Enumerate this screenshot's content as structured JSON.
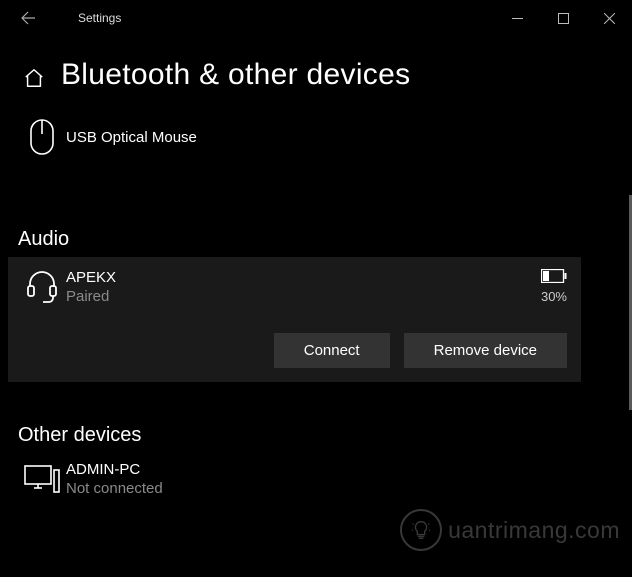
{
  "titlebar": {
    "title": "Settings"
  },
  "page": {
    "title": "Bluetooth & other devices"
  },
  "sections": {
    "mouse_section": {
      "items": [
        {
          "name": "USB Optical Mouse"
        }
      ]
    },
    "audio": {
      "title": "Audio",
      "items": [
        {
          "name": "APEKX",
          "status": "Paired",
          "battery_pct": "30%"
        }
      ],
      "actions": {
        "connect_label": "Connect",
        "remove_label": "Remove device"
      }
    },
    "other": {
      "title": "Other devices",
      "items": [
        {
          "name": "ADMIN-PC",
          "status": "Not connected"
        }
      ]
    }
  },
  "watermark": {
    "text": "uantrimang.com"
  }
}
